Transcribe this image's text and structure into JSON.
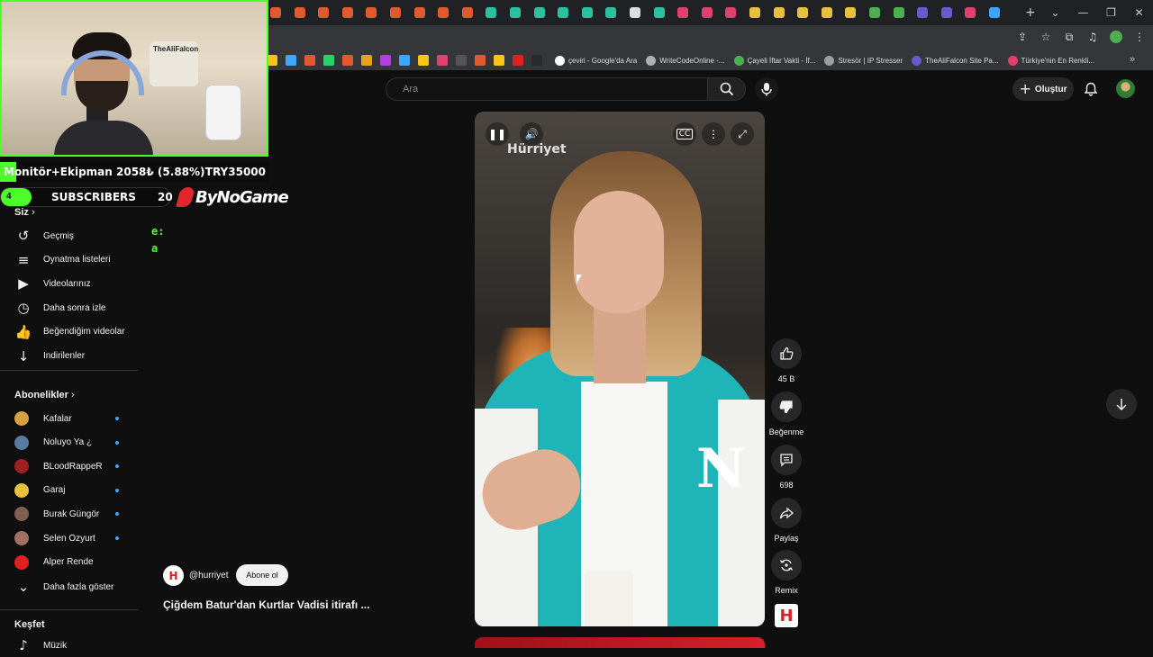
{
  "browser": {
    "tab_favicon_colors": [
      "#e05a30",
      "#e05a30",
      "#e05a30",
      "#e05a30",
      "#e05a30",
      "#e05a30",
      "#e05a30",
      "#e05a30",
      "#e05a30",
      "#2bc0a0",
      "#2bc0a0",
      "#2bc0a0",
      "#2bc0a0",
      "#2bc0a0",
      "#2bc0a0",
      "#dddddd",
      "#2bc0a0",
      "#e04070",
      "#e04070",
      "#e04070",
      "#e8c040",
      "#e8c040",
      "#e8c040",
      "#e8c040",
      "#e8c040",
      "#4caf50",
      "#4caf50",
      "#6a5acd",
      "#6a5acd",
      "#e04070",
      "#3ea6ff"
    ],
    "new_tab_label": "+",
    "bookmarks": [
      {
        "label": "çeviri - Google'da Ara",
        "color": "#ffffff"
      },
      {
        "label": "WriteCodeOnline -...",
        "color": "#b0b0b0"
      },
      {
        "label": "Çayeli İftar Vakti - İf...",
        "color": "#4caf50"
      },
      {
        "label": "Stresör | IP Stresser",
        "color": "#9e9e9e"
      },
      {
        "label": "TheAliFalcon Site Pa...",
        "color": "#6a5acd"
      },
      {
        "label": "Türkiye'nin En Renkli...",
        "color": "#e04070"
      }
    ],
    "bookmark_icon_colors": [
      "#f5c518",
      "#3ea6ff",
      "#e05a30",
      "#25d366",
      "#e05a30",
      "#e8a020",
      "#b040e0",
      "#3ea6ff",
      "#f5c518",
      "#e04070",
      "#555555",
      "#e05a30",
      "#f5c518",
      "#e02020",
      "#2a2a2a"
    ],
    "more_label": "»"
  },
  "overlay": {
    "webcam_logo_text": "TheAliFalcon",
    "donation_goal_label": "Monitör+Ekipman 2058₺ (5.88%)",
    "donation_goal_target": "TRY35000",
    "donation_fraction": 0.0588,
    "sub_count": "4",
    "sub_label": "SUBSCRIBERS",
    "sub_goal": "20",
    "sponsor": "ByNoGame",
    "chat_lines": [
      "e:",
      "a"
    ]
  },
  "sidebar": {
    "you_label": "Siz",
    "you_items": [
      {
        "icon": "history-icon",
        "glyph": "↺",
        "label": "Geçmiş"
      },
      {
        "icon": "playlists-icon",
        "glyph": "≡",
        "label": "Oynatma listeleri"
      },
      {
        "icon": "your-videos-icon",
        "glyph": "▶",
        "label": "Videolarınız"
      },
      {
        "icon": "watch-later-icon",
        "glyph": "◷",
        "label": "Daha sonra izle"
      },
      {
        "icon": "liked-videos-icon",
        "glyph": "👍",
        "label": "Beğendiğim videolar"
      },
      {
        "icon": "downloads-icon",
        "glyph": "↓",
        "label": "İndirilenler"
      }
    ],
    "subs_label": "Abonelikler",
    "subscriptions": [
      {
        "label": "Kafalar",
        "color": "#d8a040"
      },
      {
        "label": "Noluyo Ya ¿",
        "color": "#5a7aa0"
      },
      {
        "label": "BLoodRappeR",
        "color": "#a02020"
      },
      {
        "label": "Garaj",
        "color": "#e8c040"
      },
      {
        "label": "Burak Güngör",
        "color": "#806050"
      },
      {
        "label": "Selen Özyurt",
        "color": "#a07060"
      },
      {
        "label": "Alper Rende",
        "color": "#e02020"
      }
    ],
    "show_more": "Daha fazla göster",
    "explore_label": "Keşfet",
    "explore_items": [
      {
        "label": "Müzik"
      }
    ]
  },
  "topbar": {
    "search_placeholder": "Ara",
    "create_label": "Oluştur"
  },
  "short": {
    "watermark": "Hürriyet",
    "channel_handle": "@hurriyet",
    "subscribe_label": "Abone ol",
    "title": "Çiğdem Batur'dan Kurtlar Vadisi itirafı ...",
    "like_count": "45 B",
    "dislike_label": "Beğenme",
    "comment_count": "698",
    "share_label": "Paylaş",
    "remix_label": "Remix",
    "logo_letter": "H"
  }
}
